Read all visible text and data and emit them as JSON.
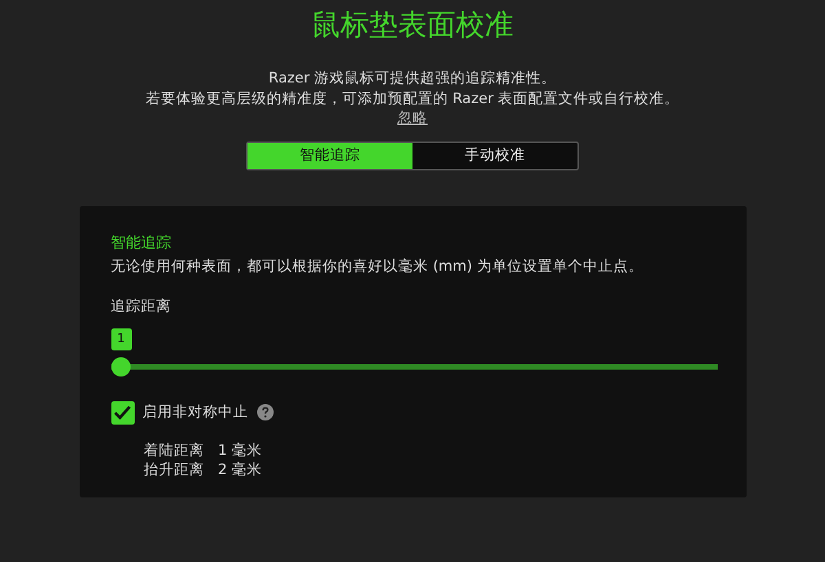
{
  "title": "鼠标垫表面校准",
  "intro": [
    "Razer 游戏鼠标可提供超强的追踪精准性。",
    "若要体验更高层级的精准度，可添加预配置的 Razer 表面配置文件或自行校准。"
  ],
  "skip_link": "忽略",
  "tabs": [
    {
      "label": "智能追踪",
      "selected": true
    },
    {
      "label": "手动校准",
      "selected": false
    }
  ],
  "panel": {
    "heading": "智能追踪",
    "description": "无论使用何种表面，都可以根据你的喜好以毫米 (mm) 为单位设置单个中止点。",
    "slider": {
      "label": "追踪距离",
      "value": "1",
      "level": 0
    },
    "asymmetric": {
      "label": "启用非对称中止",
      "checked": true
    },
    "distances": [
      {
        "label": "着陆距离",
        "value": "1 毫米"
      },
      {
        "label": "抬升距离",
        "value": "2 毫米"
      }
    ]
  }
}
